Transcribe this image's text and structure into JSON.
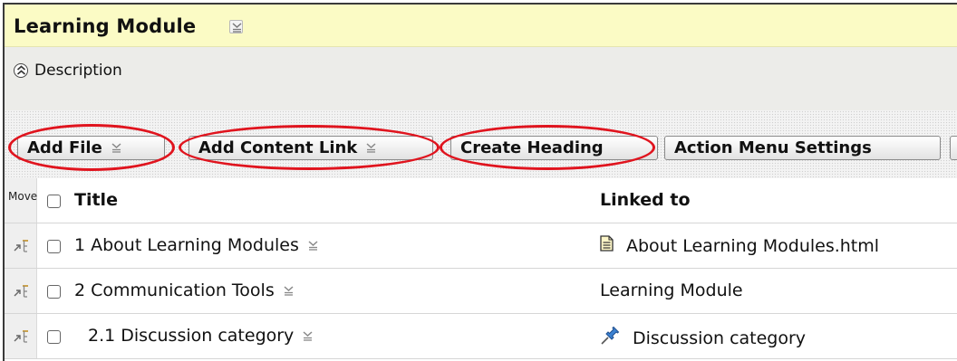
{
  "module": {
    "title": "Learning Module",
    "description_toggle": "Description"
  },
  "toolbar": {
    "add_file": "Add File",
    "add_content_link": "Add Content Link",
    "create_heading": "Create Heading",
    "action_menu_settings": "Action Menu Settings"
  },
  "table": {
    "headers": {
      "move": "Move",
      "title": "Title",
      "linked_to": "Linked to"
    },
    "rows": [
      {
        "title": "1 About Learning Modules",
        "linked_to": "About Learning Modules.html",
        "linked_icon": "document-icon"
      },
      {
        "title": "2 Communication Tools",
        "linked_to": "Learning Module",
        "linked_icon": ""
      },
      {
        "title": "2.1 Discussion category",
        "linked_to": "Discussion category",
        "linked_icon": "pushpin-icon"
      }
    ]
  },
  "colors": {
    "header_bg": "#fbfbc5",
    "description_bg": "#ecece9",
    "highlight_ring": "#e0141e"
  }
}
